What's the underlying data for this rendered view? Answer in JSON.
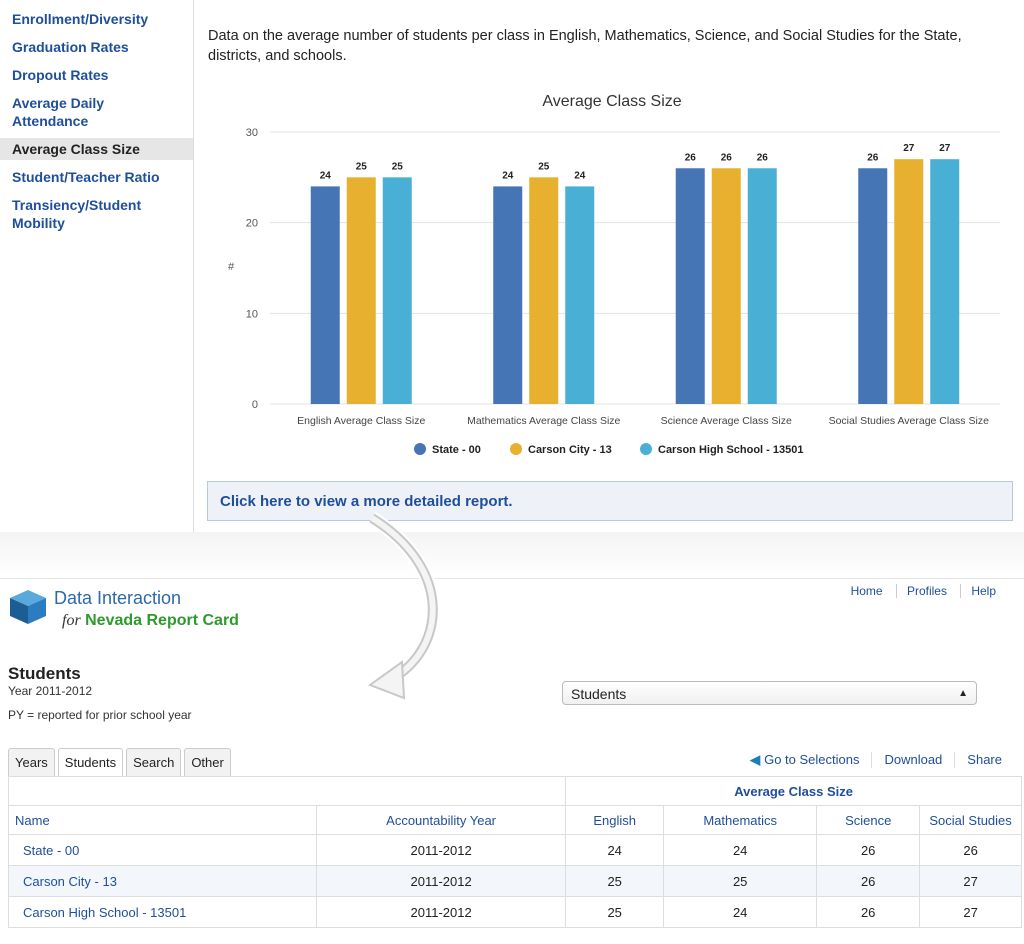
{
  "sidebar": {
    "items": [
      {
        "label": "Enrollment/Diversity"
      },
      {
        "label": "Graduation Rates"
      },
      {
        "label": "Dropout Rates"
      },
      {
        "label": "Average Daily Attendance"
      },
      {
        "label": "Average Class Size",
        "active": true
      },
      {
        "label": "Student/Teacher Ratio"
      },
      {
        "label": "Transiency/Student Mobility"
      }
    ]
  },
  "intro": "Data on the average number of students per class in English, Mathematics, Science, and Social Studies for the State, districts, and schools.",
  "chart_data": {
    "type": "bar",
    "title": "Average Class Size",
    "ylabel": "#",
    "ylim": [
      0,
      30
    ],
    "yticks": [
      0,
      10,
      20,
      30
    ],
    "categories": [
      "English Average Class Size",
      "Mathematics Average Class Size",
      "Science Average Class Size",
      "Social Studies Average Class Size"
    ],
    "series": [
      {
        "name": "State - 00",
        "color": "#4575b4",
        "values": [
          24,
          24,
          26,
          26
        ]
      },
      {
        "name": "Carson City - 13",
        "color": "#e7b02e",
        "values": [
          25,
          25,
          26,
          27
        ]
      },
      {
        "name": "Carson High School - 13501",
        "color": "#4aafd5",
        "values": [
          25,
          24,
          26,
          27
        ]
      }
    ],
    "grid": true,
    "legend": "bottom"
  },
  "detail_link": "Click here to view a more detailed report.",
  "app": {
    "title": "Data Interaction",
    "for": "for",
    "subtitle": "Nevada Report Card",
    "nav": [
      "Home",
      "Profiles",
      "Help"
    ]
  },
  "page": {
    "title": "Students",
    "year": "Year 2011-2012",
    "note": "PY = reported for prior school year",
    "select_value": "Students"
  },
  "tabs": [
    "Years",
    "Students",
    "Search",
    "Other"
  ],
  "actions": [
    "Go to Selections",
    "Download",
    "Share"
  ],
  "table": {
    "group_header": "Average Class Size",
    "headers": [
      "Name",
      "Accountability Year",
      "English",
      "Mathematics",
      "Science",
      "Social Studies"
    ],
    "rows": [
      [
        "State - 00",
        "2011-2012",
        "24",
        "24",
        "26",
        "26"
      ],
      [
        "Carson City - 13",
        "2011-2012",
        "25",
        "25",
        "26",
        "27"
      ],
      [
        "Carson High School - 13501",
        "2011-2012",
        "25",
        "24",
        "26",
        "27"
      ]
    ]
  }
}
